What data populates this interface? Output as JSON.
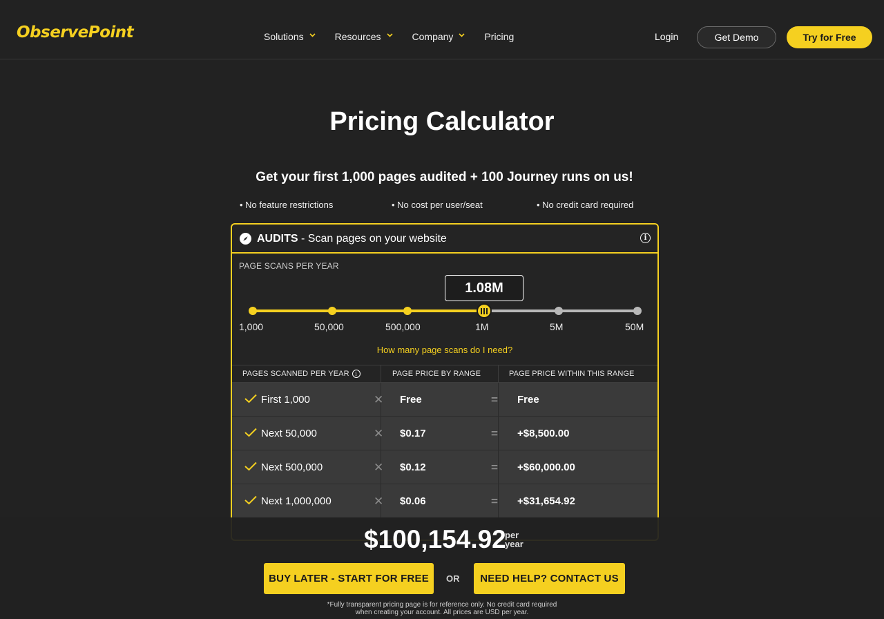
{
  "header": {
    "logo": "ObservePoint",
    "nav": [
      {
        "label": "Solutions",
        "has_dropdown": true
      },
      {
        "label": "Resources",
        "has_dropdown": true
      },
      {
        "label": "Company",
        "has_dropdown": true
      },
      {
        "label": "Pricing",
        "has_dropdown": false
      }
    ],
    "login": "Login",
    "demo": "Get Demo",
    "try": "Try for Free"
  },
  "hero": {
    "title": "Pricing Calculator",
    "promo": "Get your first 1,000 pages audited + 100 Journey runs on us!",
    "bullets": [
      "• No feature restrictions",
      "• No cost per user/seat",
      "• No credit card required"
    ]
  },
  "audits": {
    "title_bold": "AUDITS",
    "title_rest": " - Scan pages on your website",
    "scans_label": "PAGE SCANS PER YEAR",
    "selected_value": "1.08M",
    "ticks": [
      "1,000",
      "50,000",
      "500,000",
      "1M",
      "5M",
      "50M"
    ],
    "selected_tick_index": 3,
    "help_link": "How many page scans do I need?",
    "table": {
      "headers": [
        "PAGES SCANNED PER YEAR",
        "PAGE PRICE BY RANGE",
        "PAGE PRICE WITHIN THIS RANGE"
      ],
      "rows": [
        {
          "range": "First 1,000",
          "price": "Free",
          "subtotal": "Free"
        },
        {
          "range": "Next 50,000",
          "price": "$0.17",
          "subtotal": "+$8,500.00"
        },
        {
          "range": "Next 500,000",
          "price": "$0.12",
          "subtotal": "+$60,000.00"
        },
        {
          "range": "Next 1,000,000",
          "price": "$0.06",
          "subtotal": "+$31,654.92"
        }
      ]
    }
  },
  "footer": {
    "total": "$100,154.92",
    "per": "per",
    "year": "year",
    "buy_later": "BUY LATER - START FOR FREE",
    "or": "OR",
    "contact": "NEED HELP? CONTACT US",
    "disclaimer_line1": "*Fully transparent pricing page is for reference only. No credit card required",
    "disclaimer_line2": "when creating your account. All prices are USD per year."
  },
  "colors": {
    "accent": "#f5d020",
    "background": "#222222",
    "row_bg": "#3a3a3a"
  }
}
